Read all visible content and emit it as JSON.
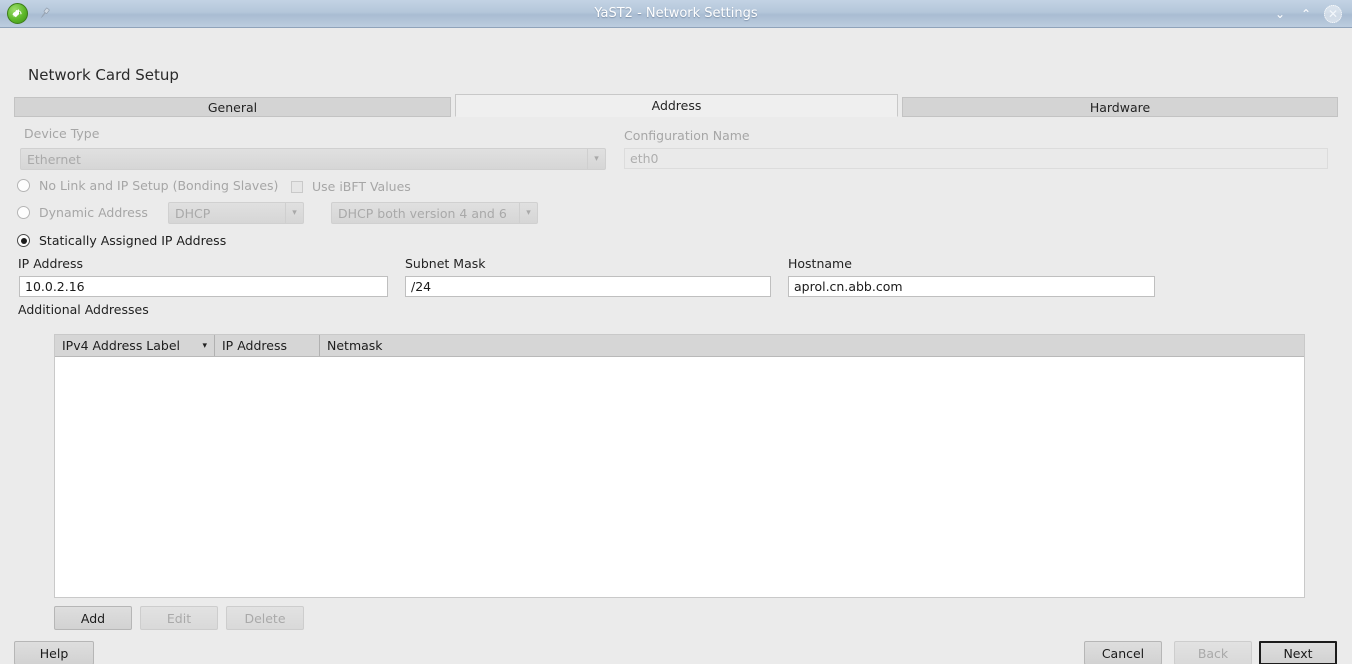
{
  "window": {
    "title": "YaST2 - Network Settings",
    "app_icon": "yast-chameleon-icon",
    "pin_icon": "pushpin-icon",
    "minimize_glyph": "⌄",
    "maximize_glyph": "⌃",
    "close_glyph": "✕"
  },
  "page": {
    "title": "Network Card Setup"
  },
  "tabs": [
    {
      "label": "General",
      "active": false
    },
    {
      "label": "Address",
      "active": true
    },
    {
      "label": "Hardware",
      "active": false
    }
  ],
  "form": {
    "device_type": {
      "label": "Device Type",
      "value": "Ethernet",
      "enabled": false
    },
    "configuration_name": {
      "label": "Configuration Name",
      "value": "eth0",
      "enabled": false
    },
    "mode": {
      "options": [
        {
          "label": "No Link and IP Setup (Bonding Slaves)",
          "selected": false
        },
        {
          "label": "Dynamic Address",
          "selected": false
        },
        {
          "label": "Statically Assigned IP Address",
          "selected": true
        }
      ]
    },
    "use_ibft": {
      "label": "Use iBFT Values",
      "checked": false,
      "enabled": false
    },
    "dynamic_protocol": {
      "value": "DHCP",
      "enabled": false
    },
    "dhcp_version": {
      "value": "DHCP both version 4 and 6",
      "enabled": false
    },
    "ip_address": {
      "label": "IP Address",
      "value": "10.0.2.16"
    },
    "subnet_mask": {
      "label": "Subnet Mask",
      "value": "/24"
    },
    "hostname": {
      "label": "Hostname",
      "value": "aprol.cn.abb.com"
    }
  },
  "additional_addresses": {
    "label": "Additional Addresses",
    "columns": [
      "IPv4 Address Label",
      "IP Address",
      "Netmask"
    ],
    "sort_glyph": "▾",
    "rows": [],
    "buttons": [
      {
        "label": "Add",
        "enabled": true
      },
      {
        "label": "Edit",
        "enabled": false
      },
      {
        "label": "Delete",
        "enabled": false
      }
    ]
  },
  "footer": {
    "help": {
      "label": "Help",
      "enabled": true
    },
    "cancel": {
      "label": "Cancel",
      "enabled": true
    },
    "back": {
      "label": "Back",
      "enabled": false
    },
    "next": {
      "label": "Next",
      "enabled": true,
      "default": true
    }
  },
  "colors": {
    "window_bg": "#ebebeb",
    "titlebar": "#b4c6da",
    "title_text": "#ffffff",
    "field_bg": "#ffffff",
    "table_header": "#d6d6d6",
    "accent_green": "#5db829"
  }
}
